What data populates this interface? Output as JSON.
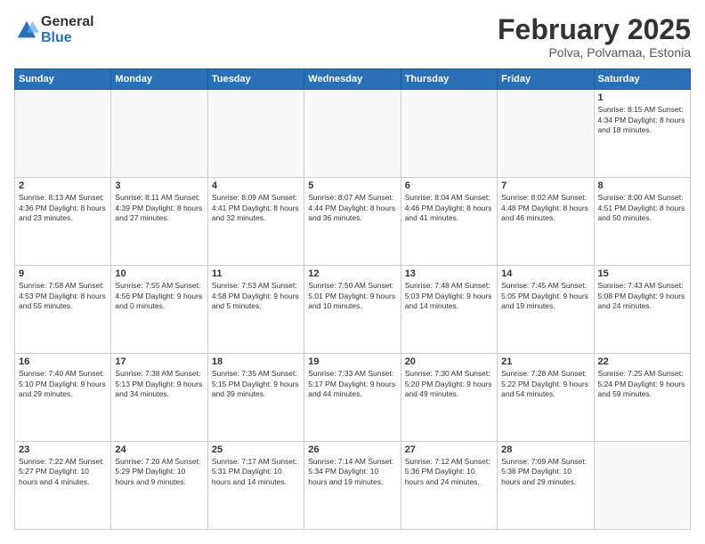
{
  "logo": {
    "general": "General",
    "blue": "Blue"
  },
  "title": "February 2025",
  "subtitle": "Polva, Polvamaa, Estonia",
  "weekdays": [
    "Sunday",
    "Monday",
    "Tuesday",
    "Wednesday",
    "Thursday",
    "Friday",
    "Saturday"
  ],
  "weeks": [
    [
      {
        "day": "",
        "info": ""
      },
      {
        "day": "",
        "info": ""
      },
      {
        "day": "",
        "info": ""
      },
      {
        "day": "",
        "info": ""
      },
      {
        "day": "",
        "info": ""
      },
      {
        "day": "",
        "info": ""
      },
      {
        "day": "1",
        "info": "Sunrise: 8:15 AM\nSunset: 4:34 PM\nDaylight: 8 hours and 18 minutes."
      }
    ],
    [
      {
        "day": "2",
        "info": "Sunrise: 8:13 AM\nSunset: 4:36 PM\nDaylight: 8 hours and 23 minutes."
      },
      {
        "day": "3",
        "info": "Sunrise: 8:11 AM\nSunset: 4:39 PM\nDaylight: 8 hours and 27 minutes."
      },
      {
        "day": "4",
        "info": "Sunrise: 8:09 AM\nSunset: 4:41 PM\nDaylight: 8 hours and 32 minutes."
      },
      {
        "day": "5",
        "info": "Sunrise: 8:07 AM\nSunset: 4:44 PM\nDaylight: 8 hours and 36 minutes."
      },
      {
        "day": "6",
        "info": "Sunrise: 8:04 AM\nSunset: 4:46 PM\nDaylight: 8 hours and 41 minutes."
      },
      {
        "day": "7",
        "info": "Sunrise: 8:02 AM\nSunset: 4:48 PM\nDaylight: 8 hours and 46 minutes."
      },
      {
        "day": "8",
        "info": "Sunrise: 8:00 AM\nSunset: 4:51 PM\nDaylight: 8 hours and 50 minutes."
      }
    ],
    [
      {
        "day": "9",
        "info": "Sunrise: 7:58 AM\nSunset: 4:53 PM\nDaylight: 8 hours and 55 minutes."
      },
      {
        "day": "10",
        "info": "Sunrise: 7:55 AM\nSunset: 4:56 PM\nDaylight: 9 hours and 0 minutes."
      },
      {
        "day": "11",
        "info": "Sunrise: 7:53 AM\nSunset: 4:58 PM\nDaylight: 9 hours and 5 minutes."
      },
      {
        "day": "12",
        "info": "Sunrise: 7:50 AM\nSunset: 5:01 PM\nDaylight: 9 hours and 10 minutes."
      },
      {
        "day": "13",
        "info": "Sunrise: 7:48 AM\nSunset: 5:03 PM\nDaylight: 9 hours and 14 minutes."
      },
      {
        "day": "14",
        "info": "Sunrise: 7:45 AM\nSunset: 5:05 PM\nDaylight: 9 hours and 19 minutes."
      },
      {
        "day": "15",
        "info": "Sunrise: 7:43 AM\nSunset: 5:08 PM\nDaylight: 9 hours and 24 minutes."
      }
    ],
    [
      {
        "day": "16",
        "info": "Sunrise: 7:40 AM\nSunset: 5:10 PM\nDaylight: 9 hours and 29 minutes."
      },
      {
        "day": "17",
        "info": "Sunrise: 7:38 AM\nSunset: 5:13 PM\nDaylight: 9 hours and 34 minutes."
      },
      {
        "day": "18",
        "info": "Sunrise: 7:35 AM\nSunset: 5:15 PM\nDaylight: 9 hours and 39 minutes."
      },
      {
        "day": "19",
        "info": "Sunrise: 7:33 AM\nSunset: 5:17 PM\nDaylight: 9 hours and 44 minutes."
      },
      {
        "day": "20",
        "info": "Sunrise: 7:30 AM\nSunset: 5:20 PM\nDaylight: 9 hours and 49 minutes."
      },
      {
        "day": "21",
        "info": "Sunrise: 7:28 AM\nSunset: 5:22 PM\nDaylight: 9 hours and 54 minutes."
      },
      {
        "day": "22",
        "info": "Sunrise: 7:25 AM\nSunset: 5:24 PM\nDaylight: 9 hours and 59 minutes."
      }
    ],
    [
      {
        "day": "23",
        "info": "Sunrise: 7:22 AM\nSunset: 5:27 PM\nDaylight: 10 hours and 4 minutes."
      },
      {
        "day": "24",
        "info": "Sunrise: 7:20 AM\nSunset: 5:29 PM\nDaylight: 10 hours and 9 minutes."
      },
      {
        "day": "25",
        "info": "Sunrise: 7:17 AM\nSunset: 5:31 PM\nDaylight: 10 hours and 14 minutes."
      },
      {
        "day": "26",
        "info": "Sunrise: 7:14 AM\nSunset: 5:34 PM\nDaylight: 10 hours and 19 minutes."
      },
      {
        "day": "27",
        "info": "Sunrise: 7:12 AM\nSunset: 5:36 PM\nDaylight: 10 hours and 24 minutes."
      },
      {
        "day": "28",
        "info": "Sunrise: 7:09 AM\nSunset: 5:38 PM\nDaylight: 10 hours and 29 minutes."
      },
      {
        "day": "",
        "info": ""
      }
    ]
  ]
}
